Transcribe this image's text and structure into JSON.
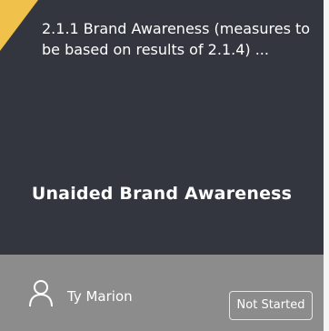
{
  "card": {
    "subtitle": "2.1.1 Brand Awareness (measures to be based on results of 2.1.4) ...",
    "title": "Unaided Brand Awareness",
    "owner_name": "Ty Marion",
    "status": "Not Started",
    "owner_icon": "person-icon",
    "colors": {
      "card_bg": "#33363f",
      "footer_bg": "#8c8c8c",
      "flag": "#f0c14b",
      "text": "#ffffff"
    }
  }
}
